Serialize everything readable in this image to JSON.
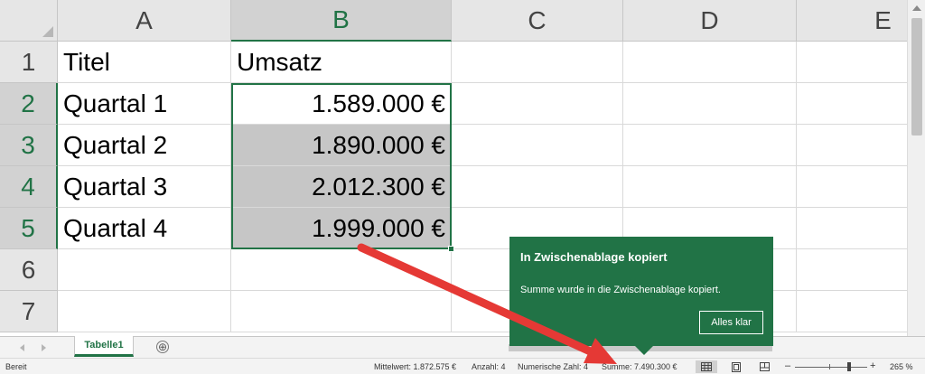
{
  "columns": [
    "A",
    "B",
    "C",
    "D",
    "E"
  ],
  "rows": [
    "1",
    "2",
    "3",
    "4",
    "5",
    "6",
    "7"
  ],
  "cells": {
    "a1": "Titel",
    "b1": "Umsatz",
    "a2": "Quartal 1",
    "b2": "1.589.000 €",
    "a3": "Quartal 2",
    "b3": "1.890.000 €",
    "a4": "Quartal 3",
    "b4": "2.012.300 €",
    "a5": "Quartal 4",
    "b5": "1.999.000 €"
  },
  "sheet_tab": "Tabelle1",
  "add_sheet": "⊕",
  "status": {
    "ready": "Bereit",
    "average": "Mittelwert: 1.872.575 €",
    "count": "Anzahl: 4",
    "numeric_count": "Numerische Zahl: 4",
    "sum": "Summe: 7.490.300 €",
    "zoom_minus": "–",
    "zoom_plus": "+",
    "zoom": "265 %"
  },
  "toast": {
    "title": "In Zwischenablage kopiert",
    "message": "Summe wurde in die Zwischenablage kopiert.",
    "button": "Alles klar"
  },
  "colors": {
    "accent": "#217346",
    "annotation_arrow": "#e53935",
    "selection_fill": "#c6c6c6"
  },
  "icons": {
    "normal_view": "grid-icon",
    "page_layout": "page-layout-icon",
    "page_break": "page-break-icon"
  }
}
